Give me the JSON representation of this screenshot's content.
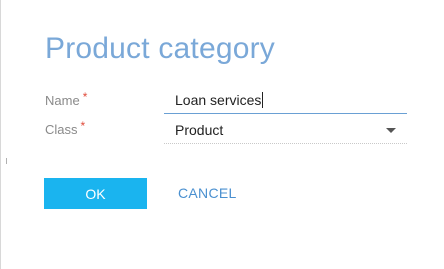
{
  "dialog": {
    "title": "Product category"
  },
  "form": {
    "name_label": "Name",
    "name_required_mark": "*",
    "name_value": "Loan services",
    "class_label": "Class",
    "class_required_mark": "*",
    "class_value": "Product"
  },
  "actions": {
    "ok_label": "OK",
    "cancel_label": "CANCEL"
  },
  "colors": {
    "title": "#7aa8d8",
    "required": "#e04a3a",
    "primary_button": "#1ab4ef",
    "link": "#4a90d0",
    "active_underline": "#6aa0d4"
  },
  "icons": {
    "class_dropdown": "chevron-down-icon"
  }
}
